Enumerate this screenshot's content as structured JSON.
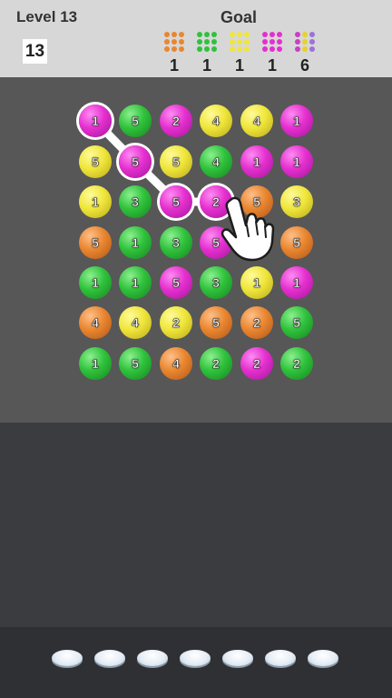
{
  "header": {
    "level_label": "Level 13",
    "moves_left": "13",
    "goal_label": "Goal"
  },
  "goals": [
    {
      "color": "#e9862f",
      "count": "1",
      "icon": "orange-balls-icon",
      "rainbow": false
    },
    {
      "color": "#2fc23c",
      "count": "1",
      "icon": "green-balls-icon",
      "rainbow": false
    },
    {
      "color": "#efe63a",
      "count": "1",
      "icon": "yellow-balls-icon",
      "rainbow": false
    },
    {
      "color": "#e52fcf",
      "count": "1",
      "icon": "magenta-balls-icon",
      "rainbow": false
    },
    {
      "color": "#b98ad8",
      "count": "6",
      "icon": "mixed-balls-icon",
      "rainbow": true
    }
  ],
  "board": {
    "rows": [
      [
        {
          "n": "1",
          "c": "magenta",
          "sel": true
        },
        {
          "n": "5",
          "c": "green"
        },
        {
          "n": "2",
          "c": "magenta"
        },
        {
          "n": "4",
          "c": "yellow"
        },
        {
          "n": "4",
          "c": "yellow"
        },
        {
          "n": "1",
          "c": "magenta"
        }
      ],
      [
        {
          "n": "5",
          "c": "yellow"
        },
        {
          "n": "5",
          "c": "magenta",
          "sel": true
        },
        {
          "n": "5",
          "c": "yellow"
        },
        {
          "n": "4",
          "c": "green"
        },
        {
          "n": "1",
          "c": "magenta"
        },
        {
          "n": "1",
          "c": "magenta"
        }
      ],
      [
        {
          "n": "1",
          "c": "yellow"
        },
        {
          "n": "3",
          "c": "green"
        },
        {
          "n": "5",
          "c": "magenta",
          "sel": true
        },
        {
          "n": "2",
          "c": "magenta",
          "sel": true
        },
        {
          "n": "5",
          "c": "orange"
        },
        {
          "n": "3",
          "c": "yellow"
        }
      ],
      [
        {
          "n": "5",
          "c": "orange"
        },
        {
          "n": "1",
          "c": "green"
        },
        {
          "n": "3",
          "c": "green"
        },
        {
          "n": "5",
          "c": "magenta"
        },
        {
          "n": "2",
          "c": "orange"
        },
        {
          "n": "5",
          "c": "orange"
        }
      ],
      [
        {
          "n": "1",
          "c": "green"
        },
        {
          "n": "1",
          "c": "green"
        },
        {
          "n": "5",
          "c": "magenta"
        },
        {
          "n": "3",
          "c": "green"
        },
        {
          "n": "1",
          "c": "yellow"
        },
        {
          "n": "1",
          "c": "magenta"
        }
      ],
      [
        {
          "n": "4",
          "c": "orange"
        },
        {
          "n": "4",
          "c": "yellow"
        },
        {
          "n": "2",
          "c": "yellow"
        },
        {
          "n": "5",
          "c": "orange"
        },
        {
          "n": "2",
          "c": "orange"
        },
        {
          "n": "5",
          "c": "green"
        }
      ],
      [
        {
          "n": "1",
          "c": "green"
        },
        {
          "n": "5",
          "c": "green"
        },
        {
          "n": "4",
          "c": "orange"
        },
        {
          "n": "2",
          "c": "green"
        },
        {
          "n": "2",
          "c": "magenta"
        },
        {
          "n": "2",
          "c": "green"
        }
      ]
    ],
    "selected_path": [
      [
        0,
        0
      ],
      [
        1,
        1
      ],
      [
        2,
        2
      ],
      [
        2,
        3
      ]
    ]
  },
  "tray": {
    "slot_count": 7
  },
  "colors": {
    "board_bg": "#575757",
    "header_bg": "#d7d7d7",
    "page_bg": "#3a3c3f"
  }
}
